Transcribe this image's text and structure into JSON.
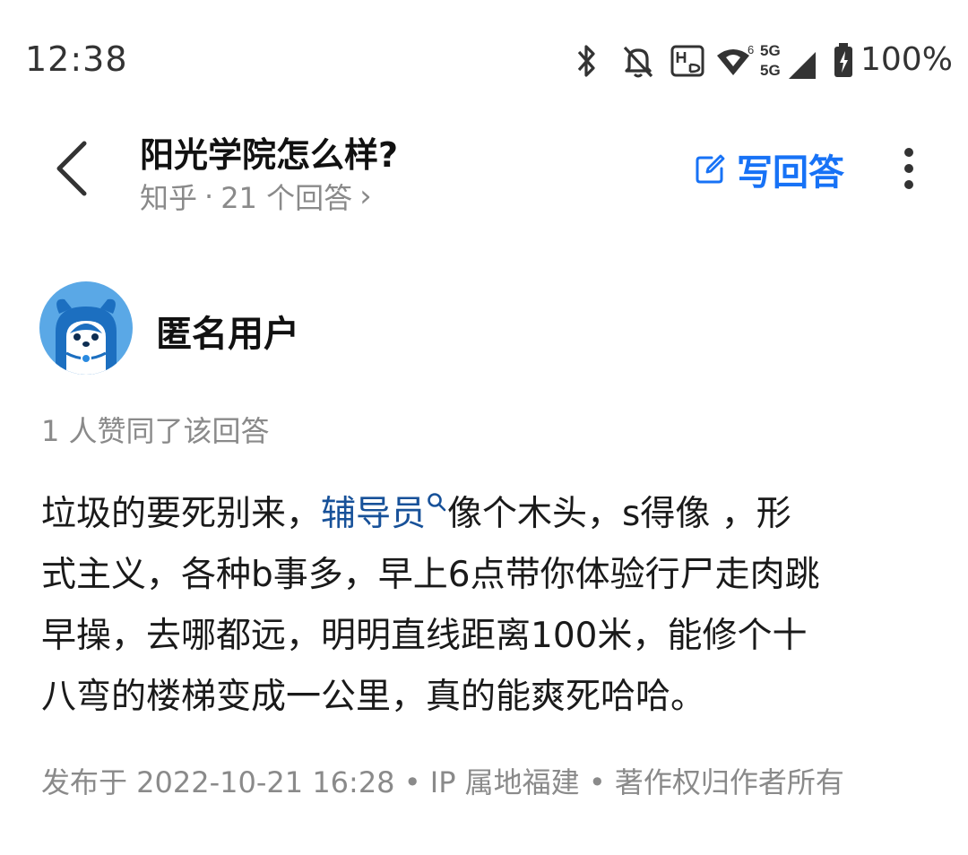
{
  "status_bar": {
    "time": "12:38",
    "battery": "100%",
    "icons": [
      "bluetooth-icon",
      "bell-off-icon",
      "hd-icon",
      "wifi-icon",
      "signal-5g-icon",
      "battery-icon"
    ],
    "network_labels": [
      "5G",
      "5G"
    ],
    "wifi_badge": "6"
  },
  "header": {
    "title": "阳光学院怎么样?",
    "source": "知乎",
    "separator": "·",
    "answer_count": "21 个回答",
    "chevron": "›",
    "write_answer_label": "写回答",
    "accent_color": "#1772f6"
  },
  "answer": {
    "author": "匿名用户",
    "vote_text": "1 人赞同了该回答",
    "lines": [
      [
        "垃圾的要死别来，",
        "辅导员",
        "像个木头，s得像 ，形"
      ],
      "式主义，各种b事多，早上6点带你体验行尸走肉跳",
      "早操，去哪都远，明明直线距离100米，能修个十",
      "八弯的楼梯变成一公里，真的能爽死哈哈。"
    ],
    "keyword_color": "#175199",
    "footer": "发布于 2022-10-21 16:28 • IP 属地福建 • 著作权归作者所有"
  }
}
